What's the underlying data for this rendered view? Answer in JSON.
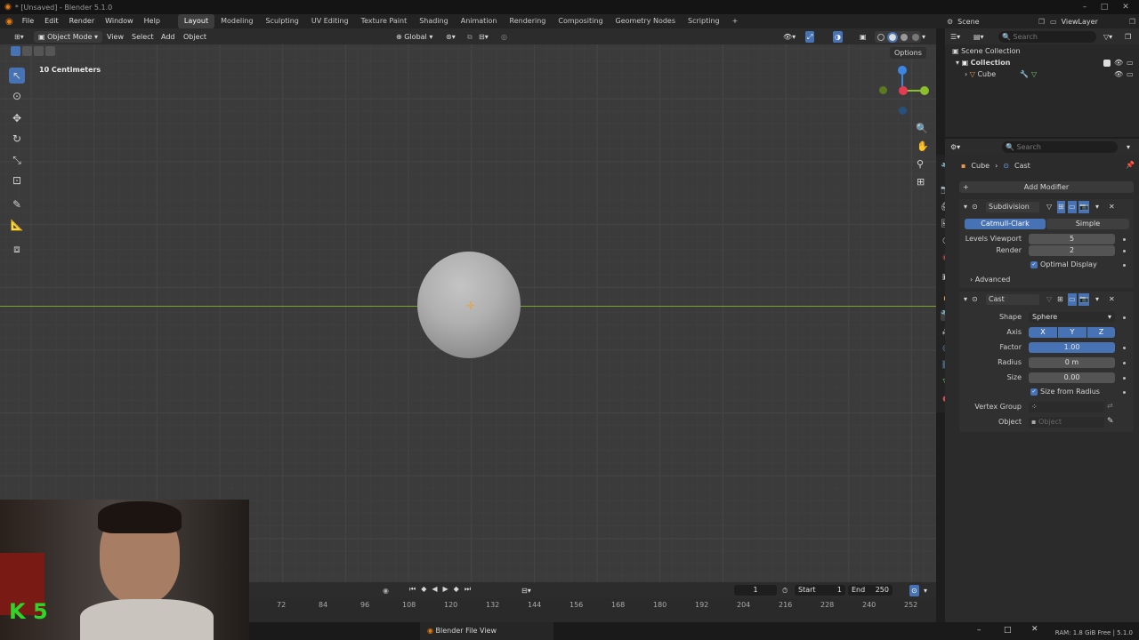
{
  "window": {
    "title": "* [Unsaved] - Blender 5.1.0"
  },
  "menu": [
    "File",
    "Edit",
    "Render",
    "Window",
    "Help"
  ],
  "workspaces": [
    "Layout",
    "Modeling",
    "Sculpting",
    "UV Editing",
    "Texture Paint",
    "Shading",
    "Animation",
    "Rendering",
    "Compositing",
    "Geometry Nodes",
    "Scripting"
  ],
  "active_workspace": "Layout",
  "scene": {
    "name": "Scene",
    "view_layer": "ViewLayer"
  },
  "viewport_header": {
    "mode": "Object Mode",
    "menus": [
      "View",
      "Select",
      "Add",
      "Object"
    ],
    "transform_orientation": "Global",
    "options_label": "Options"
  },
  "viewport": {
    "scale_label": "10 Centimeters"
  },
  "outliner": {
    "search_placeholder": "Search",
    "root": "Scene Collection",
    "collection": "Collection",
    "object": "Cube"
  },
  "properties": {
    "search_placeholder": "Search",
    "breadcrumb": [
      "Cube",
      "Cast"
    ],
    "add_modifier": "Add Modifier",
    "subdivision": {
      "name": "Subdivision",
      "types": [
        "Catmull-Clark",
        "Simple"
      ],
      "active_type": "Catmull-Clark",
      "levels_viewport_label": "Levels Viewport",
      "levels_viewport": "5",
      "render_label": "Render",
      "render": "2",
      "optimal_display": "Optimal Display",
      "advanced": "Advanced"
    },
    "cast": {
      "name": "Cast",
      "shape_label": "Shape",
      "shape": "Sphere",
      "axis_label": "Axis",
      "axes": [
        "X",
        "Y",
        "Z"
      ],
      "factor_label": "Factor",
      "factor": "1.00",
      "factor_fraction": 1.0,
      "radius_label": "Radius",
      "radius": "0 m",
      "size_label": "Size",
      "size": "0.00",
      "size_from_radius": "Size from Radius",
      "vertex_group_label": "Vertex Group",
      "object_label": "Object",
      "object_placeholder": "Object"
    }
  },
  "timeline": {
    "current_frame": "1",
    "start_label": "Start",
    "start": "1",
    "end_label": "End",
    "end": "250",
    "ticks": [
      "72",
      "84",
      "96",
      "108",
      "120",
      "132",
      "144",
      "156",
      "168",
      "180",
      "192",
      "204",
      "216",
      "228",
      "240",
      "252"
    ]
  },
  "statusbar": {
    "memory": "RAM: 1.8 GiB Free | 5.1.0"
  },
  "taskbar": {
    "window_title": "Blender File View"
  },
  "webcam": {
    "overlay_text": "K 5"
  },
  "colors": {
    "accent": "#4772b3",
    "grid": "#444444",
    "x_axis": "#e23b52",
    "y_axis": "#8bbf2c",
    "z_axis": "#3b86e3"
  }
}
